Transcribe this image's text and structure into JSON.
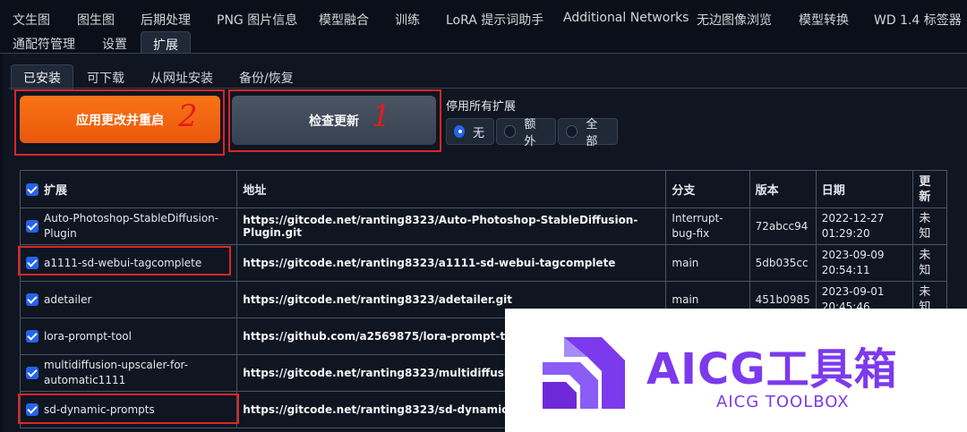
{
  "main_tabs": {
    "row1": [
      "文生图",
      "图生图",
      "后期处理",
      "PNG 图片信息",
      "模型融合",
      "训练",
      "LoRA 提示词助手",
      "Additional Networks",
      "无边图像浏览",
      "模型转换",
      "WD 1.4 标签器"
    ],
    "row2": [
      "通配符管理",
      "设置",
      "扩展"
    ],
    "active": "扩展"
  },
  "sub_tabs": [
    "已安装",
    "可下载",
    "从网址安装",
    "备份/恢复"
  ],
  "buttons": {
    "apply_label": "应用更改并重启",
    "check_label": "检查更新"
  },
  "annotations": {
    "apply_number": "2",
    "check_number": "1"
  },
  "disable": {
    "label": "停用所有扩展",
    "options": [
      "无",
      "额外",
      "全部"
    ],
    "selected": "无"
  },
  "table": {
    "headers": [
      "扩展",
      "地址",
      "分支",
      "版本",
      "日期",
      "更新"
    ],
    "rows": [
      {
        "name": "Auto-Photoshop-StableDiffusion-Plugin",
        "url": "https://gitcode.net/ranting8323/Auto-Photoshop-StableDiffusion-Plugin.git",
        "branch": "Interrupt-bug-fix",
        "version": "72abcc94",
        "date": "2022-12-27 01:29:20",
        "update": "未知",
        "highlight": false
      },
      {
        "name": "a1111-sd-webui-tagcomplete",
        "url": "https://gitcode.net/ranting8323/a1111-sd-webui-tagcomplete",
        "branch": "main",
        "version": "5db035cc",
        "date": "2023-09-09 20:54:11",
        "update": "未知",
        "highlight": true
      },
      {
        "name": "adetailer",
        "url": "https://gitcode.net/ranting8323/adetailer.git",
        "branch": "main",
        "version": "451b0985",
        "date": "2023-09-01 20:45:46",
        "update": "未知",
        "highlight": false
      },
      {
        "name": "lora-prompt-tool",
        "url": "https://github.com/a2569875/lora-prompt-tool.git",
        "branch": "",
        "version": "",
        "date": "",
        "update": "",
        "highlight": false
      },
      {
        "name": "multidiffusion-upscaler-for-automatic1111",
        "url": "https://gitcode.net/ranting8323/multidiffusion-upscaler",
        "branch": "",
        "version": "",
        "date": "",
        "update": "",
        "highlight": false
      },
      {
        "name": "sd-dynamic-prompts",
        "url": "https://gitcode.net/ranting8323/sd-dynamic-prompts.g",
        "branch": "",
        "version": "",
        "date": "",
        "update": "",
        "highlight": true
      }
    ]
  },
  "watermark": {
    "title": "AICG工具箱",
    "subtitle": "AICG TOOLBOX",
    "color": "#7c3aed"
  }
}
